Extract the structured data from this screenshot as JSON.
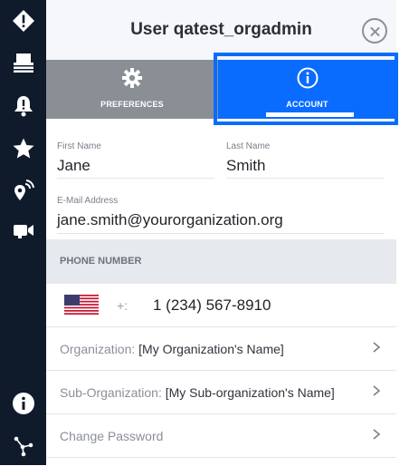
{
  "header": {
    "title": "User qatest_orgadmin"
  },
  "tabs": [
    {
      "label": "PREFERENCES",
      "icon": "gear-icon"
    },
    {
      "label": "ACCOUNT",
      "icon": "info-icon"
    }
  ],
  "account": {
    "first_name_label": "First Name",
    "first_name": "Jane",
    "last_name_label": "Last Name",
    "last_name": "Smith",
    "email_label": "E-Mail Address",
    "email": "jane.smith@yourorganization.org"
  },
  "phone_section": {
    "title": "PHONE NUMBER",
    "prefix": "+:",
    "number": "1  (234) 567-8910"
  },
  "rows": [
    {
      "label": "Organization:",
      "value": "[My Organization's Name]"
    },
    {
      "label": "Sub-Organization:",
      "value": "[My Sub-organization's Name]"
    },
    {
      "label": "Change Password",
      "value": ""
    }
  ],
  "sidebar": {
    "items": [
      "alert-diamond-icon",
      "layers-icon",
      "bell-icon",
      "star-icon",
      "location-signal-icon",
      "video-camera-icon",
      "info-circle-icon",
      "network-nodes-icon"
    ]
  },
  "colors": {
    "rail": "#0f1a2b",
    "accent": "#0a6cff",
    "tab_inactive": "#8a8f96"
  }
}
